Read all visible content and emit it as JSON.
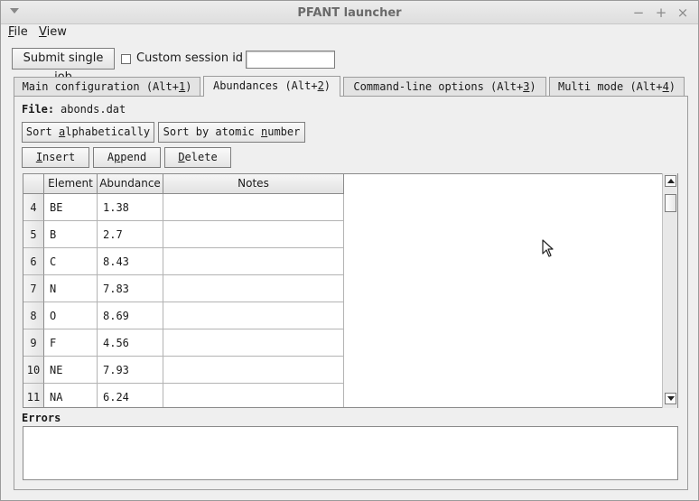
{
  "window": {
    "title": "PFANT launcher"
  },
  "menubar": {
    "items": [
      {
        "label": "File",
        "mnemonic": "F",
        "rest": "ile"
      },
      {
        "label": "View",
        "mnemonic": "V",
        "rest": "iew"
      }
    ]
  },
  "toolbar": {
    "submit_label": "Submit single job",
    "custom_session_label": "Custom session id",
    "custom_session_checked": false,
    "session_id_value": ""
  },
  "tabs": [
    {
      "pre": "Main configuration (Alt+",
      "key": "1",
      "post": ")",
      "active": false
    },
    {
      "pre": "Abundances (Alt+",
      "key": "2",
      "post": ")",
      "active": true
    },
    {
      "pre": "Command-line options (Alt+",
      "key": "3",
      "post": ")",
      "active": false
    },
    {
      "pre": "Multi mode (Alt+",
      "key": "4",
      "post": ")",
      "active": false
    }
  ],
  "abundances": {
    "file_label": "File:",
    "file_name": "abonds.dat",
    "sort_alpha": {
      "pre": "Sort ",
      "key": "a",
      "post": "lphabetically"
    },
    "sort_atomic": {
      "pre": "Sort by atomic ",
      "key": "n",
      "post": "umber"
    },
    "insert": {
      "pre": "",
      "key": "I",
      "post": "nsert"
    },
    "append": {
      "pre": "A",
      "key": "p",
      "post": "pend"
    },
    "delete": {
      "pre": "",
      "key": "D",
      "post": "elete"
    },
    "columns": [
      "Element",
      "Abundance",
      "Notes"
    ],
    "rows": [
      {
        "n": "4",
        "element": "BE",
        "abundance": "1.38",
        "notes": ""
      },
      {
        "n": "5",
        "element": "B",
        "abundance": "2.7",
        "notes": ""
      },
      {
        "n": "6",
        "element": "C",
        "abundance": "8.43",
        "notes": ""
      },
      {
        "n": "7",
        "element": "N",
        "abundance": "7.83",
        "notes": ""
      },
      {
        "n": "8",
        "element": "O",
        "abundance": "8.69",
        "notes": ""
      },
      {
        "n": "9",
        "element": "F",
        "abundance": "4.56",
        "notes": ""
      },
      {
        "n": "10",
        "element": "NE",
        "abundance": "7.93",
        "notes": ""
      },
      {
        "n": "11",
        "element": "NA",
        "abundance": "6.24",
        "notes": ""
      }
    ],
    "errors_label": "Errors",
    "errors_text": ""
  }
}
